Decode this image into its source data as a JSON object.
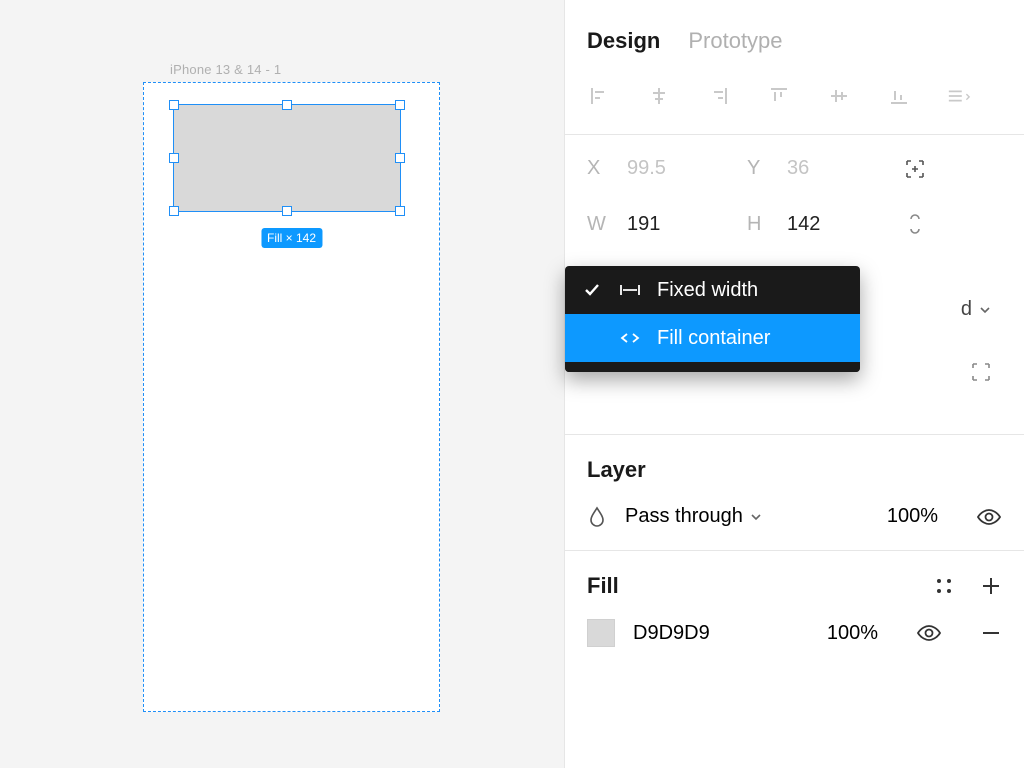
{
  "canvas": {
    "frame_label": "iPhone 13 & 14 - 1",
    "size_badge": "Fill × 142"
  },
  "panel": {
    "tabs": {
      "design": "Design",
      "prototype": "Prototype",
      "active": "design"
    },
    "position": {
      "x_label": "X",
      "x_value": "99.5",
      "y_label": "Y",
      "y_value": "36",
      "w_label": "W",
      "w_value": "191",
      "h_label": "H",
      "h_value": "142"
    },
    "resize_dropdown": {
      "fixed": "Fixed width",
      "fill": "Fill container",
      "selected": "fixed",
      "highlighted": "fill"
    },
    "resize_remnant": "d",
    "layer": {
      "title": "Layer",
      "blend_mode": "Pass through",
      "opacity": "100%"
    },
    "fill": {
      "title": "Fill",
      "hex": "D9D9D9",
      "opacity": "100%"
    }
  }
}
